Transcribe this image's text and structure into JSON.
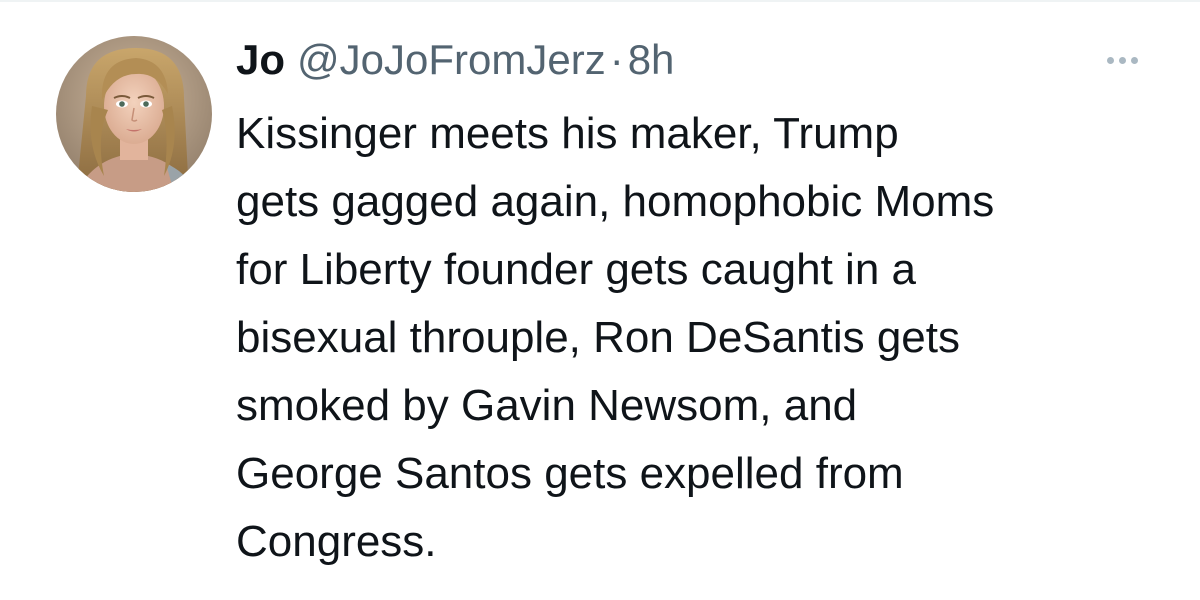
{
  "tweet": {
    "display_name": "Jo",
    "handle": "@JoJoFromJerz",
    "separator": "·",
    "timestamp": "8h",
    "avatar": {
      "icon": "user-avatar-photo"
    },
    "more_icon": "more-horizontal-icon",
    "text_lines": [
      "Kissinger meets his maker, Trump",
      "gets gagged again, homophobic Moms",
      "for Liberty founder gets caught in a",
      "bisexual throuple, Ron DeSantis gets",
      "smoked by Gavin Newsom, and",
      "George Santos gets expelled from",
      "Congress."
    ]
  },
  "colors": {
    "text_primary": "#0f1419",
    "text_secondary": "#536471",
    "more_dots": "#aab8c2",
    "divider": "#eff3f4"
  }
}
